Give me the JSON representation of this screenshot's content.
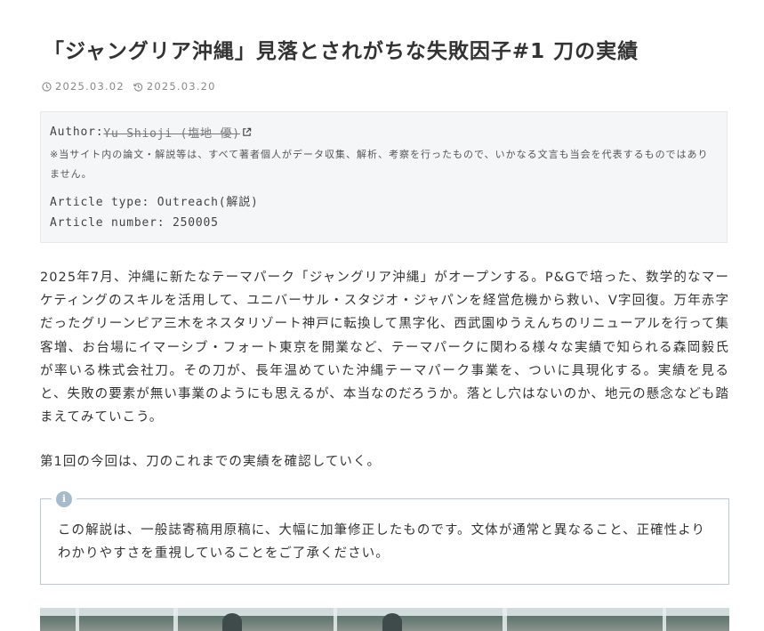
{
  "article": {
    "title": "「ジャングリア沖縄」見落とされがちな失敗因子#1 刀の実績",
    "published_date": "2025.03.02",
    "updated_date": "2025.03.20",
    "info_box": {
      "author_label": "Author: ",
      "author_name": "Yu Shioji (塩地 優)",
      "disclaimer": "※当サイト内の論文・解説等は、すべて著者個人がデータ収集、解析、考察を行ったもので、いかなる文言も当会を代表するものではありません。",
      "article_type": "Article type: Outreach(解説)",
      "article_number": "Article number: 250005"
    },
    "body": "2025年7月、沖縄に新たなテーマパーク「ジャングリア沖縄」がオープンする。P&Gで培った、数学的なマーケティングのスキルを活用して、ユニバーサル・スタジオ・ジャパンを経営危機から救い、V字回復。万年赤字だったグリーンピア三木をネスタリゾート神戸に転換して黒字化、西武園ゆうえんちのリニューアルを行って集客増、お台場にイマーシブ・フォート東京を開業など、テーマパークに関わる様々な実績で知られる森岡毅氏が率いる株式会社刀。その刀が、長年温めていた沖縄テーマパーク事業を、ついに具現化する。実績を見ると、失敗の要素が無い事業のようにも思えるが、本当なのだろうか。落とし穴はないのか、地元の懸念なども踏まえてみていこう。",
    "lead": "第1回の今回は、刀のこれまでの実績を確認していく。",
    "notice": {
      "icon": "info-icon",
      "text": "この解説は、一般誌寄稿用原稿に、大幅に加筆修正したものです。文体が通常と異なること、正確性よりわかりやすさを重視していることをご了承ください。"
    }
  },
  "icons": {
    "published": "clock-icon",
    "updated": "history-icon",
    "external": "external-link-icon"
  },
  "colors": {
    "text": "#333333",
    "meta": "#888888",
    "info_bg": "#f5f6f8",
    "notice_border": "#b9c9d6",
    "notice_icon": "#a7bccb"
  }
}
